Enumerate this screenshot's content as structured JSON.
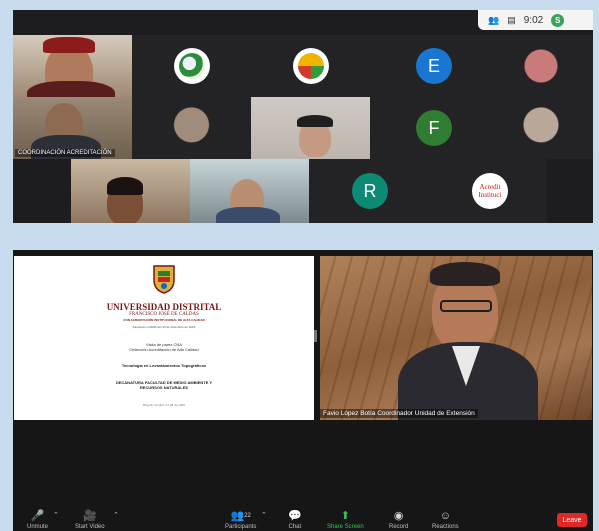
{
  "top_panel": {
    "time": "9:02",
    "self_initial": "S",
    "participant_count_icon": "participants-icon",
    "tiles": [
      {
        "kind": "camera"
      },
      {
        "kind": "logo",
        "colors": [
          "#2e8b3e",
          "#e8f3ff"
        ]
      },
      {
        "kind": "logo",
        "colors": [
          "#f0b400",
          "#2e9d3c"
        ]
      },
      {
        "kind": "initial",
        "letter": "E",
        "color": "#1977d2"
      },
      {
        "kind": "camera"
      },
      {
        "kind": "camera",
        "name": "COORDINACIÓN ACREDITACIÓN"
      },
      {
        "kind": "camera"
      },
      {
        "kind": "camera"
      },
      {
        "kind": "initial",
        "letter": "F",
        "color": "#2e7d32"
      },
      {
        "kind": "camera"
      },
      {
        "kind": "camera"
      },
      {
        "kind": "camera"
      },
      {
        "kind": "initial",
        "letter": "R",
        "color": "#0d8a74"
      },
      {
        "kind": "logo",
        "text": [
          "Acredit",
          "Instituci"
        ]
      }
    ]
  },
  "slide": {
    "university": "UNIVERSIDAD DISTRITAL",
    "subtitle": "FRANCISCO JOSÉ DE CALDAS",
    "tagline": "CON ACREDITACIÓN INSTITUCIONAL DE ALTA CALIDAD",
    "resolution": "Resolución 23096 del 15 de diciembre de 2016",
    "visit_lines": [
      "Visita de pares CNA",
      "Obtención Acreditación de Alta Calidad"
    ],
    "program": "Tecnología en Levantamientos Topográficos",
    "faculty_lines": [
      "DECANATURA FACULTAD DE MEDIO AMBIENTE Y",
      "RECURSOS NATURALES"
    ],
    "date": "Bogotá, Octubre 27-28 de 2020"
  },
  "speaker": {
    "name": "Favio López Botía Coordinador Unidad de Extensión"
  },
  "toolbar": {
    "unmute": "Unmute",
    "start_video": "Start Video",
    "participants": "Participants",
    "participants_count": "22",
    "chat": "Chat",
    "share_screen": "Share Screen",
    "record": "Record",
    "reactions": "Reactions",
    "leave": "Leave"
  },
  "colors": {
    "background": "#c9dbef",
    "panel": "#1d1d1f",
    "leave": "#e02828",
    "share_screen": "#2ea043"
  }
}
